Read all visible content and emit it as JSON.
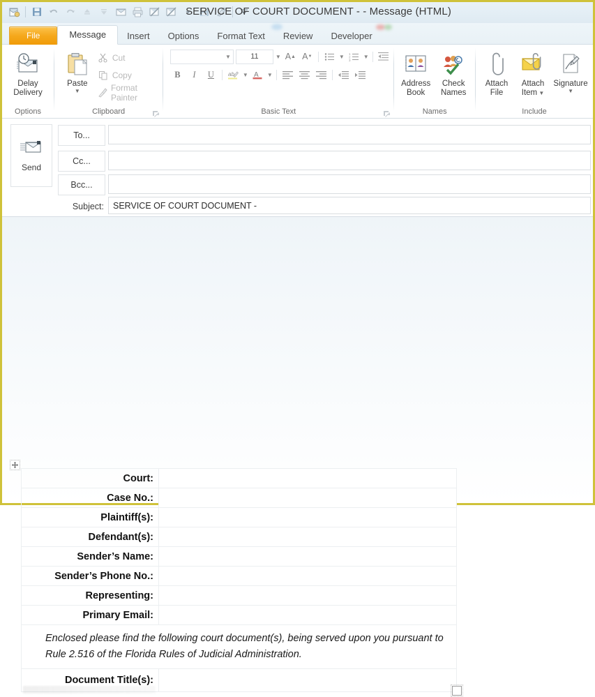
{
  "window": {
    "title": "SERVICE OF COURT DOCUMENT -  - Message (HTML)",
    "border_color": "#cfc23a"
  },
  "quick_access_toolbar": {
    "items": [
      {
        "name": "outlook-envelope-icon"
      },
      {
        "name": "save-icon"
      },
      {
        "name": "undo-icon"
      },
      {
        "name": "redo-icon"
      },
      {
        "name": "previous-item-icon"
      },
      {
        "name": "next-item-icon"
      },
      {
        "name": "message-icon"
      },
      {
        "name": "print-icon"
      },
      {
        "name": "send-receive-icon"
      },
      {
        "name": "send-receive-options-icon"
      },
      {
        "name": "save-as-icon"
      },
      {
        "name": "clean-up-icon"
      },
      {
        "name": "customize-qat-icon"
      }
    ]
  },
  "tabs": [
    {
      "label": "File",
      "type": "file",
      "active": false
    },
    {
      "label": "Message",
      "type": "normal",
      "active": true
    },
    {
      "label": "Insert",
      "type": "normal",
      "active": false
    },
    {
      "label": "Options",
      "type": "normal",
      "active": false
    },
    {
      "label": "Format Text",
      "type": "normal",
      "active": false
    },
    {
      "label": "Review",
      "type": "normal",
      "active": false
    },
    {
      "label": "Developer",
      "type": "normal",
      "active": false
    }
  ],
  "ribbon": {
    "groups": [
      {
        "label": "Options"
      },
      {
        "label": "Clipboard"
      },
      {
        "label": "Basic Text"
      },
      {
        "label": "Names"
      },
      {
        "label": "Include"
      }
    ],
    "options_group": {
      "delay_delivery": "Delay\nDelivery",
      "delay_delivery_line1": "Delay",
      "delay_delivery_line2": "Delivery"
    },
    "clipboard_group": {
      "paste_label": "Paste",
      "cut_label": "Cut",
      "copy_label": "Copy",
      "format_painter_label": "Format Painter"
    },
    "basic_text_group": {
      "font_name": "",
      "font_size": "11",
      "bold_label": "B",
      "italic_label": "I",
      "underline_label": "U"
    },
    "names_group": {
      "address_book_line1": "Address",
      "address_book_line2": "Book",
      "check_names_line1": "Check",
      "check_names_line2": "Names"
    },
    "include_group": {
      "attach_file_line1": "Attach",
      "attach_file_line2": "File",
      "attach_item_line1": "Attach",
      "attach_item_line2": "Item",
      "signature_label": "Signature"
    }
  },
  "compose": {
    "send_label": "Send",
    "to_label": "To...",
    "cc_label": "Cc...",
    "bcc_label": "Bcc...",
    "subject_label": "Subject:",
    "to_value": "",
    "cc_value": "",
    "bcc_value": "",
    "subject_value": "SERVICE OF COURT DOCUMENT -"
  },
  "body_table": {
    "rows": [
      {
        "label": "Court:",
        "value": ""
      },
      {
        "label": "Case No.:",
        "value": ""
      },
      {
        "label": "Plaintiff(s):",
        "value": ""
      },
      {
        "label": "Defendant(s):",
        "value": ""
      },
      {
        "label": "Sender’s Name:",
        "value": ""
      },
      {
        "label": "Sender’s Phone No.:",
        "value": ""
      },
      {
        "label": "Representing:",
        "value": ""
      },
      {
        "label": "Primary Email:",
        "value": ""
      }
    ],
    "notice": "Enclosed please find  the following court document(s), being served upon you pursuant to Rule 2.516 of the Florida Rules of Judicial Administration.",
    "final_row": {
      "label": "Document Title(s):",
      "value": ""
    }
  }
}
